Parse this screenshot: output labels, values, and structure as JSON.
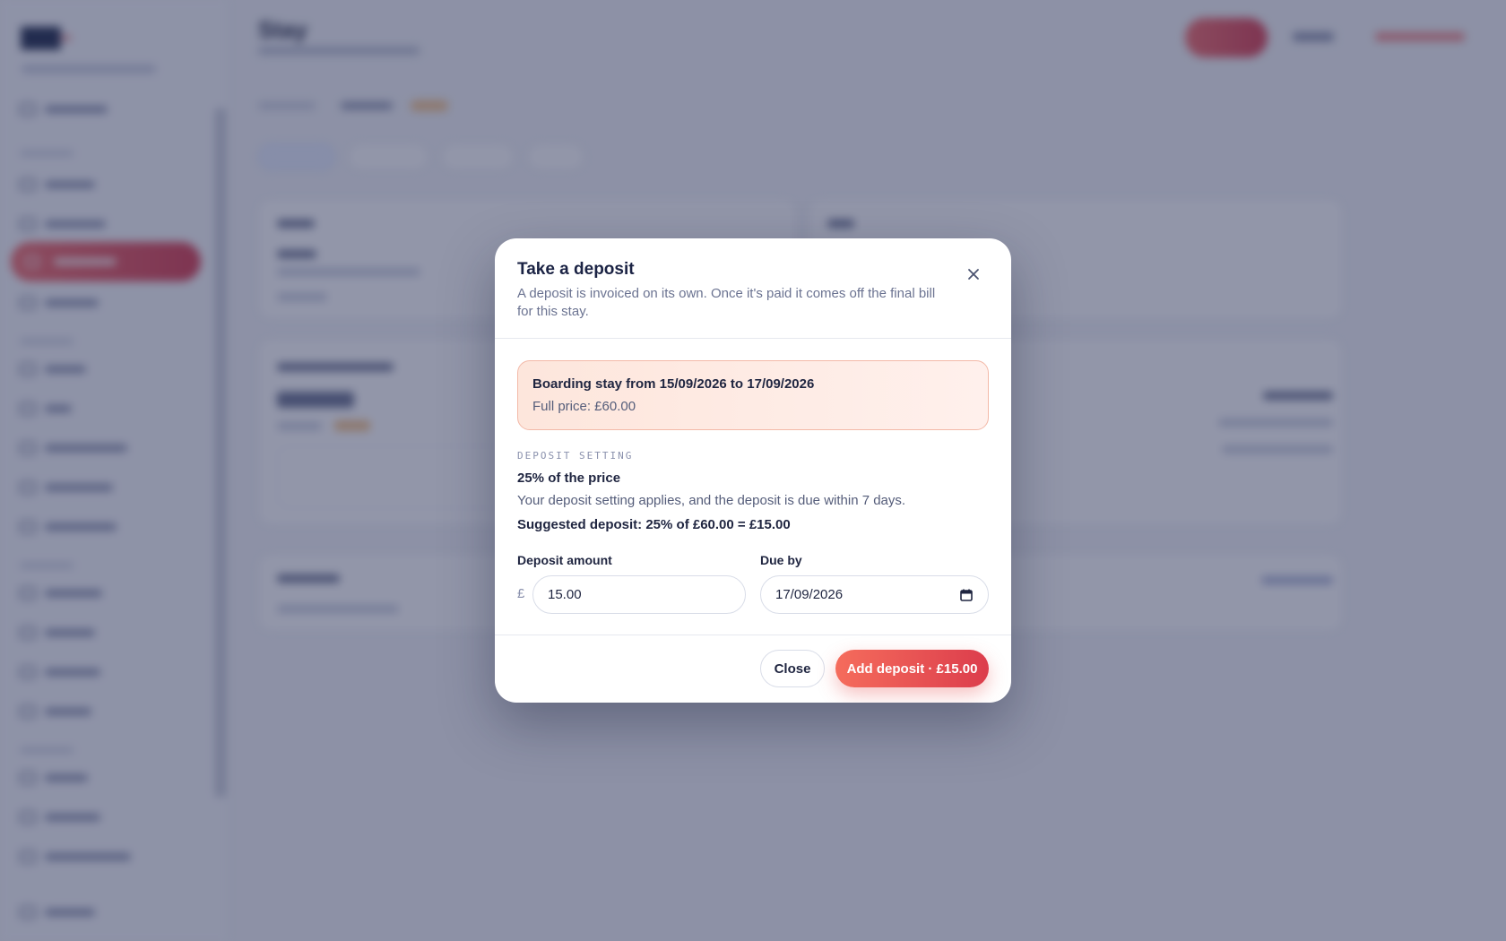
{
  "app": {
    "page_title": "Stay"
  },
  "modal": {
    "title": "Take a deposit",
    "description": "A deposit is invoiced on its own. Once it's paid it comes off the final bill for this stay.",
    "stay_summary": {
      "title": "Boarding stay from 15/09/2026 to 17/09/2026",
      "full_price": "Full price: £60.00"
    },
    "deposit_setting": {
      "label": "DEPOSIT SETTING",
      "value": "25% of the price",
      "note": "Your deposit setting applies, and the deposit is due within 7 days.",
      "suggested": "Suggested deposit: 25% of £60.00 = £15.00"
    },
    "form": {
      "amount_label": "Deposit amount",
      "currency_symbol": "£",
      "amount_value": "15.00",
      "due_label": "Due by",
      "due_value": "17/09/2026"
    },
    "buttons": {
      "close": "Close",
      "add": "Add deposit · £15.00"
    }
  },
  "icons": {
    "close": "close-icon",
    "calendar": "calendar-icon"
  },
  "colors": {
    "accent": "#e8524f",
    "overlay": "#262e54"
  }
}
